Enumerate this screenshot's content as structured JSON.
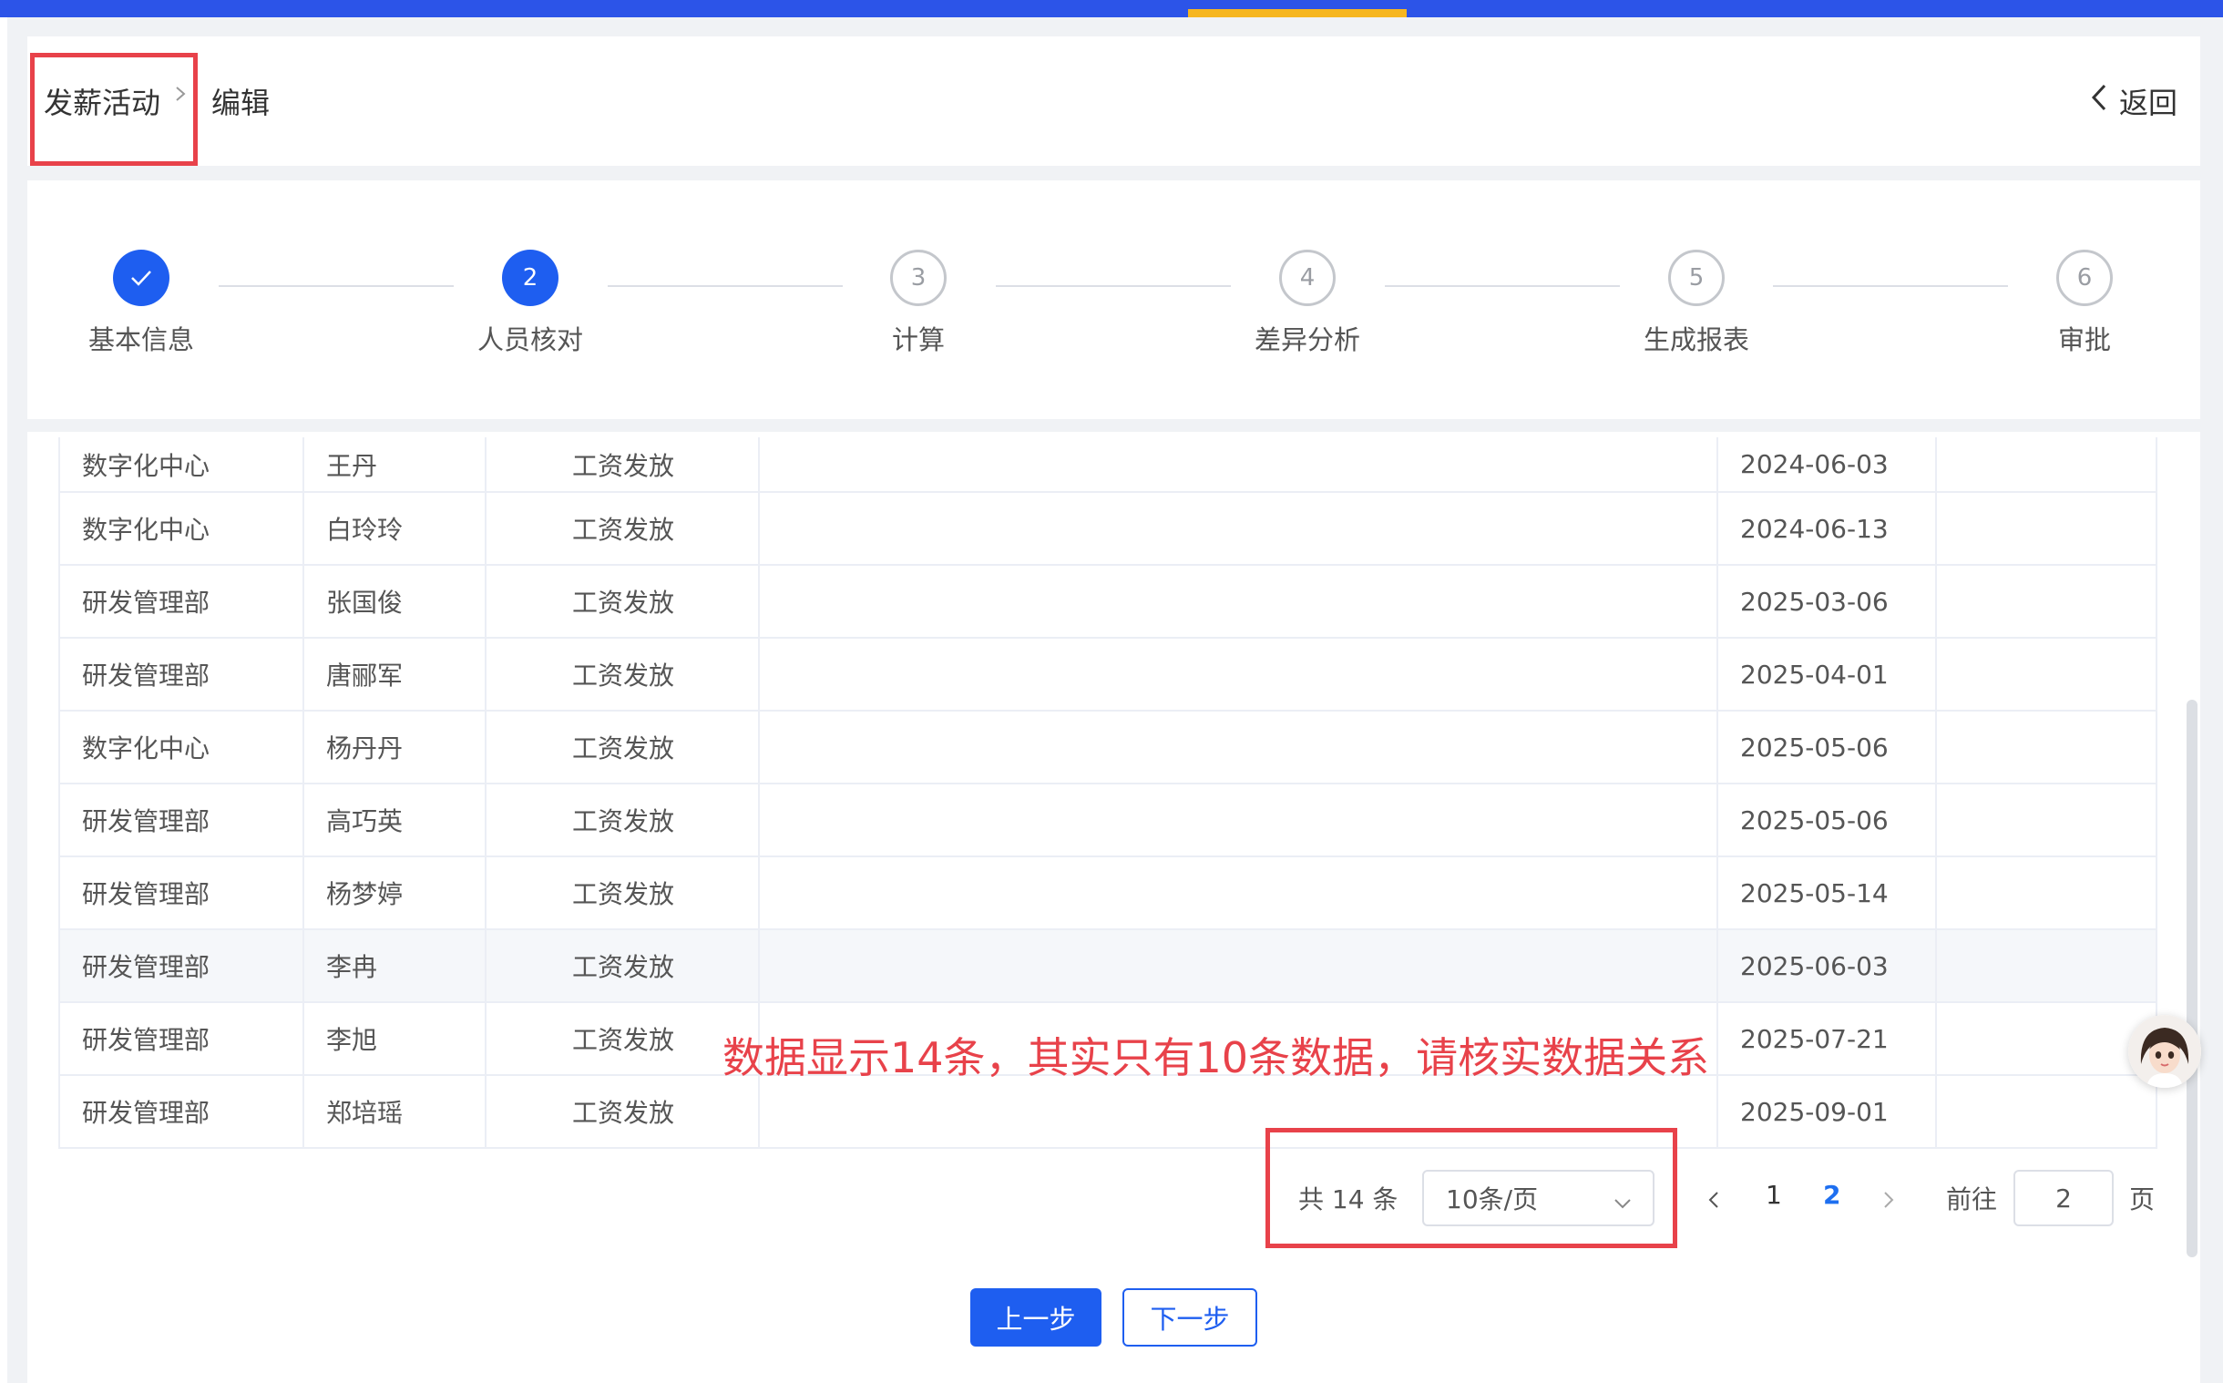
{
  "breadcrumb": {
    "root": "发薪活动",
    "current": "编辑"
  },
  "header": {
    "back_label": "返回"
  },
  "steps": [
    {
      "number": "1",
      "label": "基本信息",
      "state": "done"
    },
    {
      "number": "2",
      "label": "人员核对",
      "state": "active"
    },
    {
      "number": "3",
      "label": "计算",
      "state": "todo"
    },
    {
      "number": "4",
      "label": "差异分析",
      "state": "todo"
    },
    {
      "number": "5",
      "label": "生成报表",
      "state": "todo"
    },
    {
      "number": "6",
      "label": "审批",
      "state": "todo"
    }
  ],
  "table": {
    "rows": [
      {
        "dept": "数字化中心",
        "name": "王丹",
        "type": "工资发放",
        "date": "2024-06-03"
      },
      {
        "dept": "数字化中心",
        "name": "白玲玲",
        "type": "工资发放",
        "date": "2024-06-13"
      },
      {
        "dept": "研发管理部",
        "name": "张国俊",
        "type": "工资发放",
        "date": "2025-03-06"
      },
      {
        "dept": "研发管理部",
        "name": "唐郦军",
        "type": "工资发放",
        "date": "2025-04-01"
      },
      {
        "dept": "数字化中心",
        "name": "杨丹丹",
        "type": "工资发放",
        "date": "2025-05-06"
      },
      {
        "dept": "研发管理部",
        "name": "高巧英",
        "type": "工资发放",
        "date": "2025-05-06"
      },
      {
        "dept": "研发管理部",
        "name": "杨梦婷",
        "type": "工资发放",
        "date": "2025-05-14"
      },
      {
        "dept": "研发管理部",
        "name": "李冉",
        "type": "工资发放",
        "date": "2025-06-03"
      },
      {
        "dept": "研发管理部",
        "name": "李旭",
        "type": "工资发放",
        "date": "2025-07-21"
      },
      {
        "dept": "研发管理部",
        "name": "郑培瑶",
        "type": "工资发放",
        "date": "2025-09-01"
      }
    ]
  },
  "annotation": "数据显示14条，其实只有10条数据，请核实数据关系",
  "pagination": {
    "total_label": "共 14 条",
    "page_size": "10条/页",
    "pages": [
      "1",
      "2"
    ],
    "current_page": "2",
    "goto_label": "前往",
    "goto_value": "2",
    "goto_suffix": "页"
  },
  "footer": {
    "prev_label": "上一步",
    "next_label": "下一步"
  },
  "colors": {
    "primary": "#1e5ef0",
    "highlight": "#e8424a",
    "topbar": "#2c54e8",
    "topbar_active": "#f6b620"
  }
}
